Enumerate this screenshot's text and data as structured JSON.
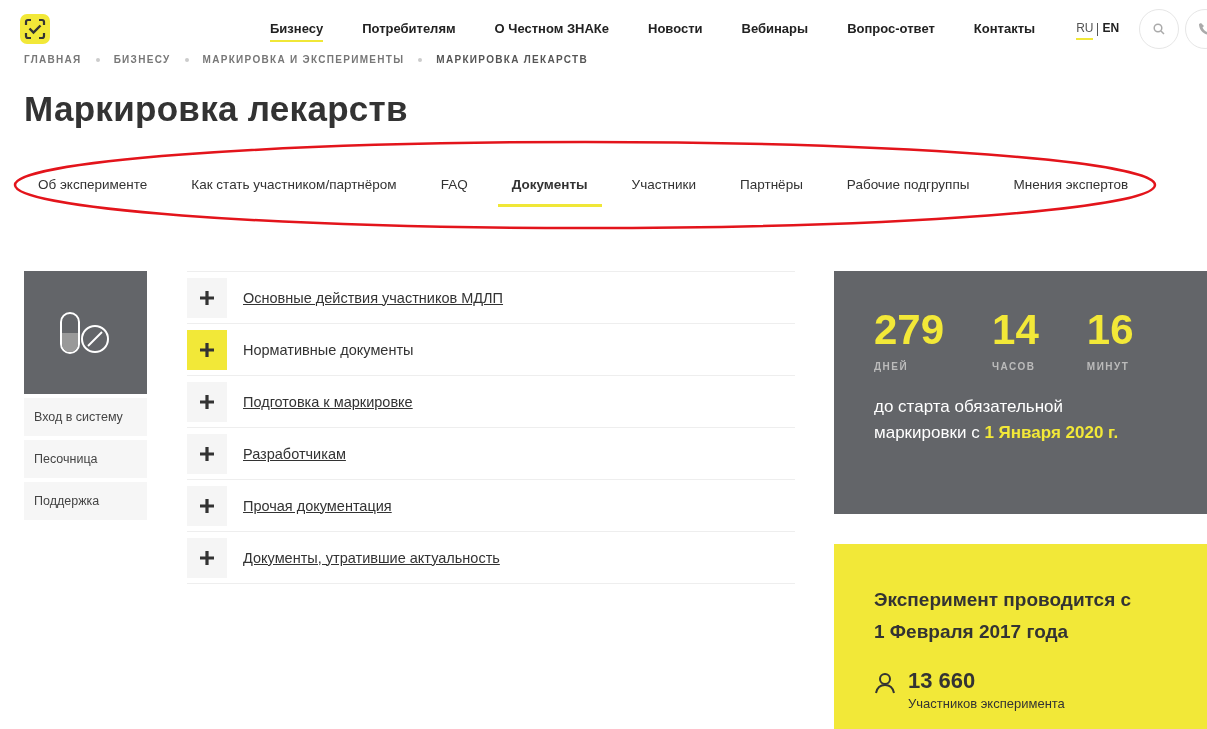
{
  "nav": [
    {
      "label": "Бизнесу",
      "selected": true
    },
    {
      "label": "Потребителям",
      "selected": false
    },
    {
      "label": "О Честном ЗНАКе",
      "selected": false
    },
    {
      "label": "Новости",
      "selected": false
    },
    {
      "label": "Вебинары",
      "selected": false
    },
    {
      "label": "Вопрос-ответ",
      "selected": false
    },
    {
      "label": "Контакты",
      "selected": false
    }
  ],
  "languages": [
    {
      "label": "RU",
      "selected": true
    },
    {
      "label": "EN",
      "selected": false
    }
  ],
  "breadcrumbs": [
    "ГЛАВНАЯ",
    "БИЗНЕСУ",
    "МАРКИРОВКА И ЭКСПЕРИМЕНТЫ",
    "МАРКИРОВКА ЛЕКАРСТВ"
  ],
  "title": "Маркировка лекарств",
  "tabs": [
    {
      "label": "Об эксперименте",
      "selected": false
    },
    {
      "label": "Как стать участником/партнёром",
      "selected": false
    },
    {
      "label": "FAQ",
      "selected": false
    },
    {
      "label": "Документы",
      "selected": true
    },
    {
      "label": "Участники",
      "selected": false
    },
    {
      "label": "Партнёры",
      "selected": false
    },
    {
      "label": "Рабочие подгруппы",
      "selected": false
    },
    {
      "label": "Мнения экспертов",
      "selected": false
    }
  ],
  "sidebar": {
    "items": [
      "Вход в систему",
      "Песочница",
      "Поддержка"
    ]
  },
  "documents": [
    {
      "label": "Основные действия участников МДЛП",
      "selected": false
    },
    {
      "label": "Нормативные документы",
      "selected": true
    },
    {
      "label": "Подготовка к маркировке",
      "selected": false
    },
    {
      "label": "Разработчикам",
      "selected": false
    },
    {
      "label": "Прочая документация",
      "selected": false
    },
    {
      "label": "Документы, утратившие актуальность",
      "selected": false
    }
  ],
  "countdown": {
    "units": [
      {
        "value": "279",
        "label": "ДНЕЙ"
      },
      {
        "value": "14",
        "label": "ЧАСОВ"
      },
      {
        "value": "16",
        "label": "МИНУТ"
      }
    ],
    "text": "до старта обязательной маркировки с",
    "highlight": "1 Января 2020 г."
  },
  "experiment": {
    "title": "Эксперимент проводится с 1 Февраля 2017 года",
    "count": "13 660",
    "count_label": "Участников эксперимента"
  }
}
